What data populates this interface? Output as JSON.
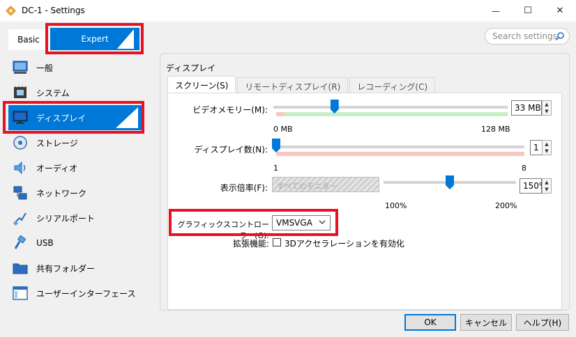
{
  "window": {
    "title": "DC-1 - Settings",
    "close_glyph": "✕",
    "max_glyph": "☐",
    "min_glyph": "—"
  },
  "mode": {
    "basic_label": "Basic",
    "expert_label": "Expert",
    "selected": "Expert"
  },
  "search": {
    "placeholder": "Search settings"
  },
  "sidebar": {
    "items": [
      {
        "label": "一般",
        "icon": "general-icon"
      },
      {
        "label": "システム",
        "icon": "system-chip-icon"
      },
      {
        "label": "ディスプレイ",
        "icon": "display-monitor-icon",
        "selected": true
      },
      {
        "label": "ストレージ",
        "icon": "storage-disk-icon"
      },
      {
        "label": "オーディオ",
        "icon": "audio-speaker-icon"
      },
      {
        "label": "ネットワーク",
        "icon": "network-icon"
      },
      {
        "label": "シリアルポート",
        "icon": "serial-port-icon"
      },
      {
        "label": "USB",
        "icon": "usb-icon"
      },
      {
        "label": "共有フォルダー",
        "icon": "shared-folder-icon"
      },
      {
        "label": "ユーザーインターフェース",
        "icon": "user-interface-icon"
      }
    ]
  },
  "section": {
    "title": "ディスプレイ"
  },
  "tabs": [
    {
      "label": "スクリーン(S)",
      "active": true
    },
    {
      "label": "リモートディスプレイ(R)",
      "active": false
    },
    {
      "label": "レコーディング(C)",
      "active": false
    }
  ],
  "screen": {
    "video_memory": {
      "label": "ビデオメモリー(M):",
      "value": "33 MB",
      "min_label": "0 MB",
      "max_label": "128 MB",
      "fraction": 0.26
    },
    "monitor_count": {
      "label": "ディスプレイ数(N):",
      "value": "1",
      "min_label": "1",
      "max_label": "8",
      "fraction": 0.0
    },
    "scale_factor": {
      "label": "表示倍率(F):",
      "monitor_select": "すべてのモニター",
      "value": "150%",
      "min_label": "100%",
      "max_label": "200%",
      "fraction": 0.5
    },
    "graphics_controller": {
      "label": "グラフィックスコントローラー(G):",
      "value": "VMSVGA"
    },
    "extended_features": {
      "label": "拡張機能:",
      "checkbox_label": "3Dアクセラレーションを有効化",
      "checked": false
    }
  },
  "buttons": {
    "ok": "OK",
    "cancel": "キャンセル",
    "help": "ヘルプ(H)"
  },
  "colors": {
    "accent": "#0078d7",
    "highlight_red": "#e81123",
    "slider_green": "#c8efc8",
    "slider_red": "#f6c8c0"
  }
}
